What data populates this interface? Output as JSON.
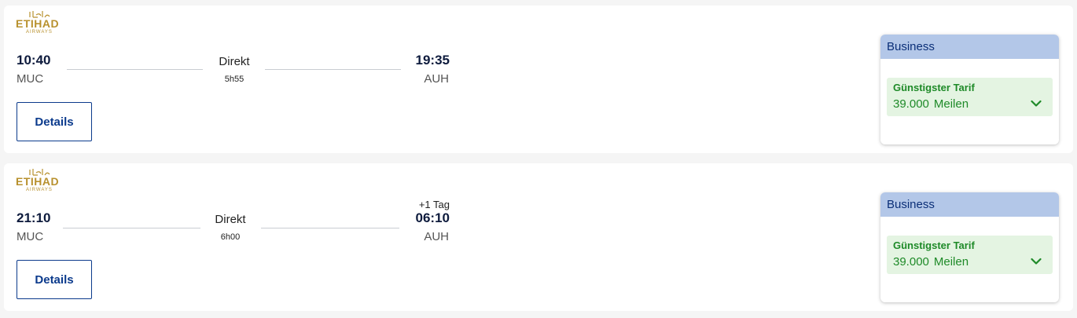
{
  "flights": [
    {
      "airline": {
        "logo_text": "ETIHAD",
        "logo_sub": "AIRWAYS",
        "logo_arabic": "الاتحاد"
      },
      "departure": {
        "time": "10:40",
        "airport": "MUC"
      },
      "arrival": {
        "time": "19:35",
        "airport": "AUH",
        "day_offset": ""
      },
      "stops": "Direkt",
      "duration": "5h55",
      "details_label": "Details",
      "fare": {
        "cabin": "Business",
        "tag": "Günstigster Tarif",
        "amount": "39.000",
        "unit": "Meilen"
      }
    },
    {
      "airline": {
        "logo_text": "ETIHAD",
        "logo_sub": "AIRWAYS",
        "logo_arabic": "الاتحاد"
      },
      "departure": {
        "time": "21:10",
        "airport": "MUC"
      },
      "arrival": {
        "time": "06:10",
        "airport": "AUH",
        "day_offset": "+1 Tag"
      },
      "stops": "Direkt",
      "duration": "6h00",
      "details_label": "Details",
      "fare": {
        "cabin": "Business",
        "tag": "Günstigster Tarif",
        "amount": "39.000",
        "unit": "Meilen"
      }
    }
  ],
  "colors": {
    "brand_gold": "#b8912e",
    "primary_blue": "#0b3a8c",
    "fare_header_bg": "#b3c7e8",
    "fare_offer_bg": "#e4f4e2",
    "fare_offer_text": "#1e8a28"
  },
  "icons": {
    "expand": "chevron-down-icon",
    "airline": "etihad-logo"
  }
}
